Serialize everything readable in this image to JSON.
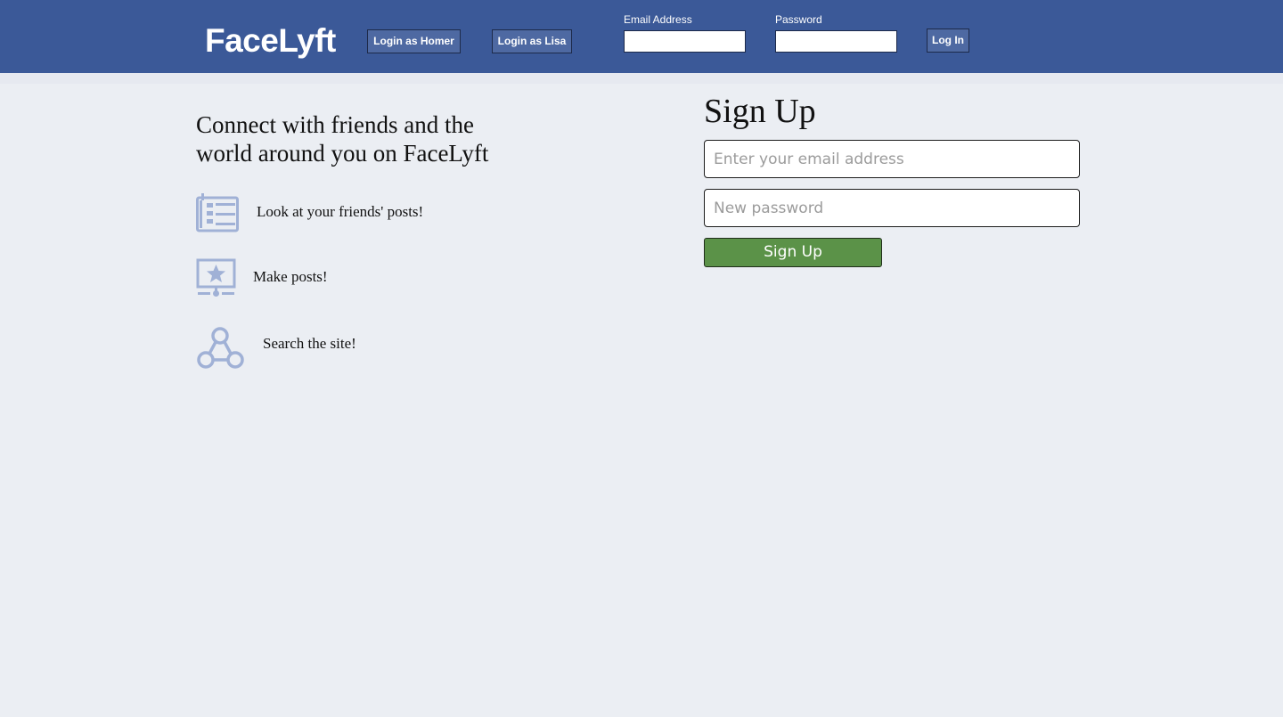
{
  "header": {
    "logo": "FaceLyft",
    "demo_buttons": [
      "Login as Homer",
      "Login as Lisa"
    ],
    "email_label": "Email Address",
    "password_label": "Password",
    "email_value": "",
    "password_value": "",
    "login_label": "Log In"
  },
  "intro": {
    "tagline": "Connect with friends and the world around you on FaceLyft",
    "features": [
      {
        "icon": "newsfeed-icon",
        "text": "Look at your friends' posts!"
      },
      {
        "icon": "post-icon",
        "text": "Make posts!"
      },
      {
        "icon": "network-icon",
        "text": "Search the site!"
      }
    ]
  },
  "signup": {
    "title": "Sign Up",
    "email_placeholder": "Enter your email address",
    "password_placeholder": "New password",
    "button_label": "Sign Up"
  },
  "colors": {
    "header_bg": "#3b5998",
    "page_bg": "#ebeef3",
    "icon_color": "#a0b1d6",
    "signup_button": "#5b9248"
  }
}
